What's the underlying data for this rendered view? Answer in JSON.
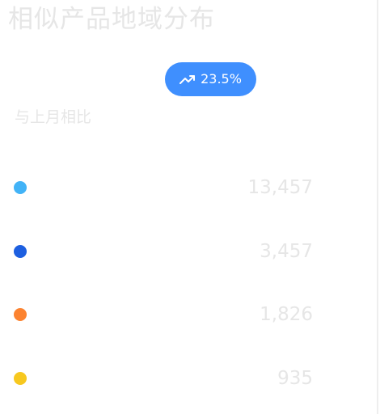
{
  "header": {
    "title": "相似产品地域分布"
  },
  "trend": {
    "value_label": "23.5%",
    "icon": "trending-up-icon",
    "color": "#3f8ffe"
  },
  "comparison": {
    "label": "与上月相比"
  },
  "legend": {
    "items": [
      {
        "value": "13,457",
        "color": "#42b3f7"
      },
      {
        "value": "3,457",
        "color": "#1d5fe0"
      },
      {
        "value": "1,826",
        "color": "#fc8330"
      },
      {
        "value": "935",
        "color": "#f7c81f"
      }
    ]
  }
}
